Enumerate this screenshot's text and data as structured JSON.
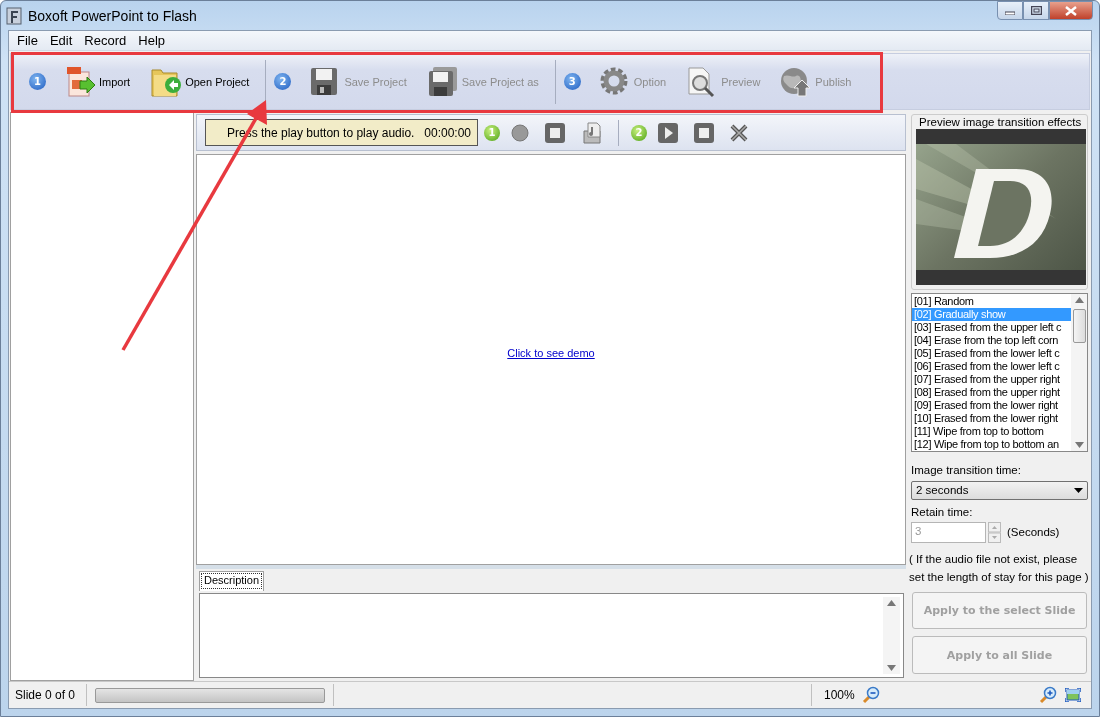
{
  "window": {
    "title": "Boxoft PowerPoint to Flash"
  },
  "menu": [
    "File",
    "Edit",
    "Record",
    "Help"
  ],
  "toolbar": [
    {
      "kind": "step",
      "label": "1"
    },
    {
      "kind": "button",
      "label": "Import",
      "disabled": false
    },
    {
      "kind": "button",
      "label": "Open Project",
      "disabled": false
    },
    {
      "kind": "separator"
    },
    {
      "kind": "step",
      "label": "2"
    },
    {
      "kind": "button",
      "label": "Save Project",
      "disabled": true
    },
    {
      "kind": "button",
      "label": "Save Project as",
      "disabled": true
    },
    {
      "kind": "separator"
    },
    {
      "kind": "step",
      "label": "3"
    },
    {
      "kind": "button",
      "label": "Option",
      "disabled": true
    },
    {
      "kind": "button",
      "label": "Preview",
      "disabled": true
    },
    {
      "kind": "button",
      "label": "Publish",
      "disabled": true
    }
  ],
  "player": {
    "message": "Press the play button to play audio.",
    "time": "00:00:00",
    "record_step": "1",
    "play_step": "2"
  },
  "canvas": {
    "link": "Click to see demo"
  },
  "description": {
    "tabs": [
      {
        "label": "Description",
        "selected": true
      }
    ]
  },
  "effects": {
    "title": "Preview image transition effects",
    "items": [
      {
        "label": "[01] Random",
        "selected": false
      },
      {
        "label": "[02] Gradually show",
        "selected": true
      },
      {
        "label": "[03] Erased from the upper left c",
        "selected": false
      },
      {
        "label": "[04] Erase from the top left corn",
        "selected": false
      },
      {
        "label": "[05] Erased from the lower left c",
        "selected": false
      },
      {
        "label": "[06] Erased from the lower left c",
        "selected": false
      },
      {
        "label": "[07] Erased from the upper right",
        "selected": false
      },
      {
        "label": "[08] Erased from the upper right",
        "selected": false
      },
      {
        "label": "[09] Erased from the lower right",
        "selected": false
      },
      {
        "label": "[10] Erased from the lower right",
        "selected": false
      },
      {
        "label": "[11] Wipe from top to bottom",
        "selected": false
      },
      {
        "label": "[12] Wipe from top to bottom an",
        "selected": false
      }
    ]
  },
  "transition": {
    "label": "Image transition time:",
    "value": "2 seconds"
  },
  "retain": {
    "label": "Retain time:",
    "value": "3",
    "unit": "(Seconds)",
    "disabled": true
  },
  "note": "( If the audio file not exist, please set the length of stay for this page )",
  "buttons": [
    {
      "label": "Apply to the select Slide",
      "disabled": true
    },
    {
      "label": "Apply to all Slide",
      "disabled": true
    }
  ],
  "status_bar": {
    "slide": "Slide 0 of 0",
    "progress": {
      "level": 0
    },
    "zoom": "100%"
  }
}
